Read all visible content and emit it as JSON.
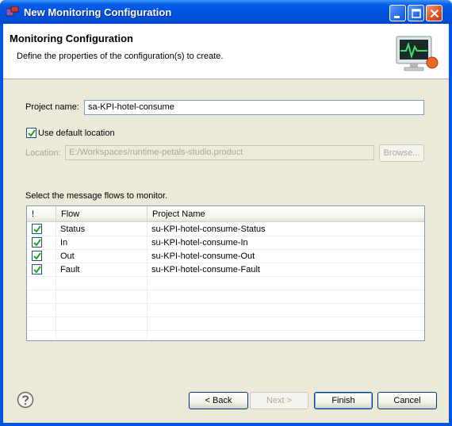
{
  "window": {
    "title": "New Monitoring Configuration"
  },
  "banner": {
    "title": "Monitoring Configuration",
    "description": "Define the properties of the configuration(s) to create.",
    "icon": "monitor-heartbeat-icon"
  },
  "form": {
    "project_name_label": "Project name:",
    "project_name_value": "sa-KPI-hotel-consume",
    "use_default_location_label": "Use default location",
    "use_default_location_checked": true,
    "location_label": "Location:",
    "location_value": "E:/Workspaces/runtime-petals-studio.product",
    "browse_label": "Browse..."
  },
  "flows": {
    "instruction": "Select the message flows to monitor.",
    "columns": [
      "!",
      "Flow",
      "Project Name"
    ],
    "rows": [
      {
        "checked": true,
        "flow": "Status",
        "project": "su-KPI-hotel-consume-Status"
      },
      {
        "checked": true,
        "flow": "In",
        "project": "su-KPI-hotel-consume-In"
      },
      {
        "checked": true,
        "flow": "Out",
        "project": "su-KPI-hotel-consume-Out"
      },
      {
        "checked": true,
        "flow": "Fault",
        "project": "su-KPI-hotel-consume-Fault"
      }
    ]
  },
  "buttons": {
    "back": "< Back",
    "next": "Next >",
    "finish": "Finish",
    "cancel": "Cancel"
  },
  "colors": {
    "titlebar": "#0054e3",
    "dialog_bg": "#ece9d8",
    "close_button": "#e05a2a"
  }
}
